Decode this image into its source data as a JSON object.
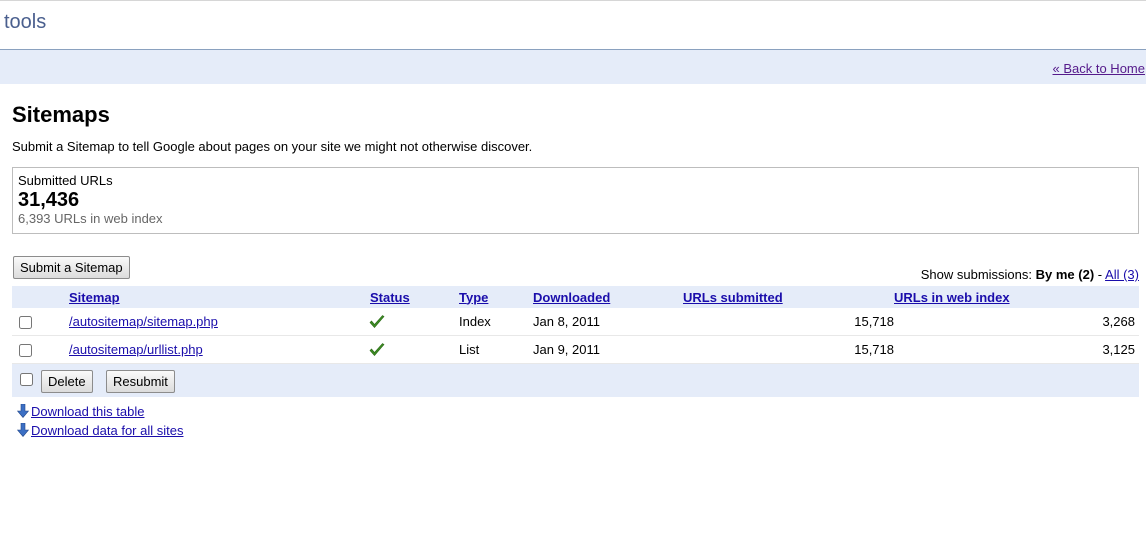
{
  "header": {
    "title": "tools"
  },
  "nav": {
    "back_link": "« Back to Home"
  },
  "page": {
    "title": "Sitemaps",
    "subtitle": "Submit a Sitemap to tell Google about pages on your site we might not otherwise discover."
  },
  "stats": {
    "label": "Submitted URLs",
    "value": "31,436",
    "sub": "6,393 URLs in web index"
  },
  "toolbar": {
    "submit_label": "Submit a Sitemap",
    "show_prefix": "Show submissions:",
    "by_me": "By me (2)",
    "separator": "-",
    "all": "All (3)"
  },
  "table": {
    "headers": {
      "sitemap": "Sitemap",
      "status": "Status",
      "type": "Type",
      "downloaded": "Downloaded",
      "urls_submitted": "URLs submitted",
      "urls_indexed": "URLs in web index"
    },
    "rows": [
      {
        "sitemap": "/autositemap/sitemap.php",
        "status": "ok",
        "type": "Index",
        "downloaded": "Jan 8, 2011",
        "urls_submitted": "15,718",
        "urls_indexed": "3,268"
      },
      {
        "sitemap": "/autositemap/urllist.php",
        "status": "ok",
        "type": "List",
        "downloaded": "Jan 9, 2011",
        "urls_submitted": "15,718",
        "urls_indexed": "3,125"
      }
    ]
  },
  "actions": {
    "delete_label": "Delete",
    "resubmit_label": "Resubmit"
  },
  "downloads": {
    "table": "Download this table",
    "all_sites": "Download data for all sites"
  },
  "colors": {
    "accent_bg": "#e5ecf9",
    "link": "#1a0dab",
    "check": "#3d8b24"
  }
}
